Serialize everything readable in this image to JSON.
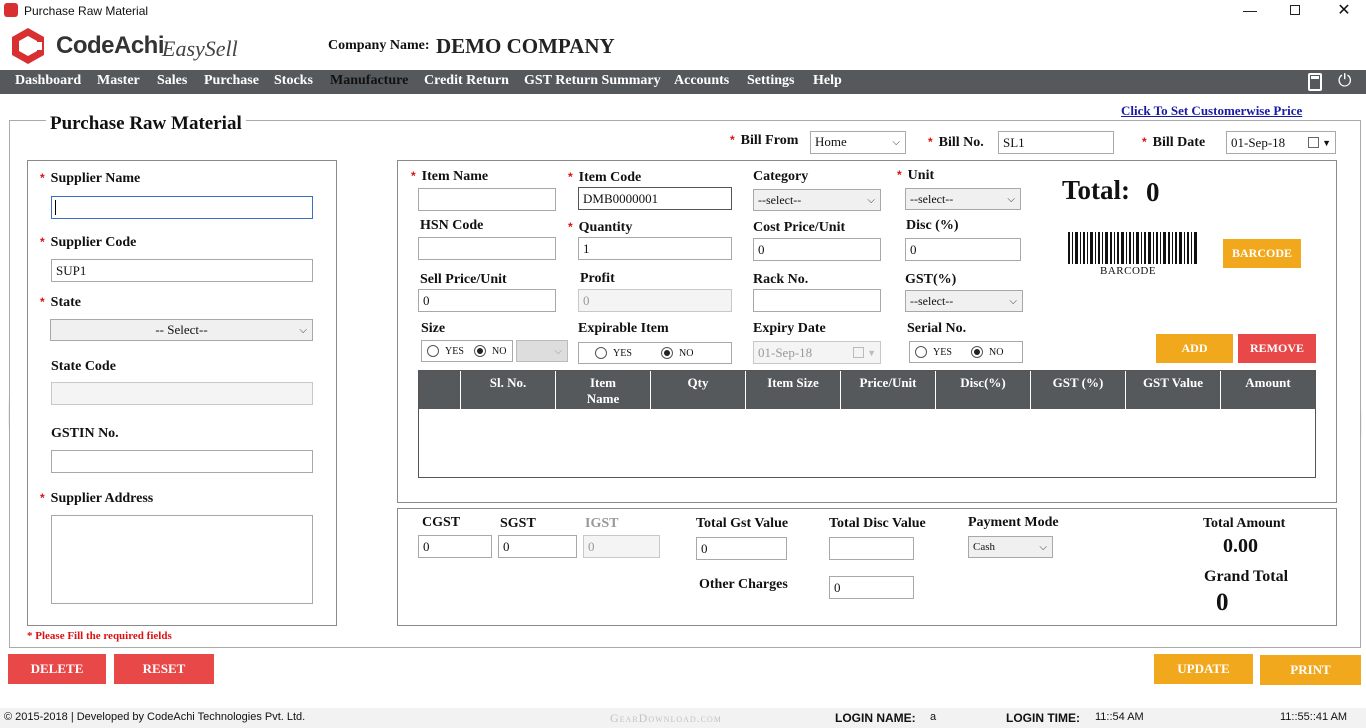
{
  "window": {
    "title": "Purchase Raw Material"
  },
  "brand": {
    "name": "CodeAchi",
    "product": "EasySell"
  },
  "company": {
    "label": "Company Name:",
    "value": "DEMO COMPANY"
  },
  "nav": [
    "Dashboard",
    "Master",
    "Sales",
    "Purchase",
    "Stocks",
    "Manufacture",
    "Credit Return",
    "GST Return Summary",
    "Accounts",
    "Settings",
    "Help"
  ],
  "link_customer_price": "Click To Set Customerwise Price",
  "form_title": "Purchase Raw Material",
  "bill": {
    "from_label": "Bill From",
    "from_value": "Home",
    "no_label": "Bill No.",
    "no_value": "SL1",
    "date_label": "Bill Date",
    "date_value": "01-Sep-18"
  },
  "supplier": {
    "name_label": "Supplier Name",
    "name_value": "",
    "code_label": "Supplier Code",
    "code_value": "SUP1",
    "state_label": "State",
    "state_value": "-- Select--",
    "state_code_label": "State Code",
    "state_code_value": "",
    "gstin_label": "GSTIN No.",
    "gstin_value": "",
    "address_label": "Supplier Address",
    "address_value": ""
  },
  "required_note": "* Please Fill the required fields",
  "item": {
    "name_label": "Item Name",
    "name_value": "",
    "code_label": "Item Code",
    "code_value": "DMB0000001",
    "category_label": "Category",
    "category_value": "--select--",
    "unit_label": "Unit",
    "unit_value": "--select--",
    "hsn_label": "HSN Code",
    "hsn_value": "",
    "qty_label": "Quantity",
    "qty_value": "1",
    "cost_label": "Cost Price/Unit",
    "cost_value": "0",
    "disc_label": "Disc (%)",
    "disc_value": "0",
    "sell_label": "Sell Price/Unit",
    "sell_value": "0",
    "profit_label": "Profit",
    "profit_value": "0",
    "rack_label": "Rack No.",
    "rack_value": "",
    "gst_label": "GST(%)",
    "gst_value": "--select--",
    "size_label": "Size",
    "expirable_label": "Expirable Item",
    "expiry_label": "Expiry Date",
    "expiry_value": "01-Sep-18",
    "serial_label": "Serial No.",
    "yes": "YES",
    "no": "NO"
  },
  "total": {
    "label": "Total:",
    "value": "0"
  },
  "barcode": {
    "caption": "BARCODE",
    "button": "BARCODE"
  },
  "buttons": {
    "add": "ADD",
    "remove": "REMOVE",
    "delete": "DELETE",
    "reset": "RESET",
    "update": "UPDATE",
    "print": "PRINT"
  },
  "table": {
    "columns": [
      "",
      "Sl. No.",
      "Item Name",
      "Qty",
      "Item Size",
      "Price/Unit",
      "Disc(%)",
      "GST (%)",
      "GST Value",
      "Amount"
    ]
  },
  "summary": {
    "cgst_label": "CGST",
    "cgst_value": "0",
    "sgst_label": "SGST",
    "sgst_value": "0",
    "igst_label": "IGST",
    "igst_value": "0",
    "total_gst_label": "Total Gst Value",
    "total_gst_value": "0",
    "total_disc_label": "Total Disc Value",
    "total_disc_value": "",
    "other_label": "Other Charges",
    "other_value": "0",
    "payment_label": "Payment Mode",
    "payment_value": "Cash",
    "total_amount_label": "Total Amount",
    "total_amount_value": "0.00",
    "grand_total_label": "Grand Total",
    "grand_total_value": "0"
  },
  "footer": {
    "copyright": "© 2015-2018 | Developed by CodeAchi Technologies Pvt. Ltd.",
    "watermark": "GearDownload.com",
    "login_name_label": "LOGIN NAME:",
    "login_name_value": "a",
    "login_time_label": "LOGIN TIME:",
    "login_time_value": "11::54 AM",
    "clock": "11::55::41 AM"
  },
  "colors": {
    "nav_bg": "#55595c",
    "orange": "#f2a81c",
    "red": "#e94848",
    "link": "#1a1aa8",
    "required": "#d11111"
  }
}
